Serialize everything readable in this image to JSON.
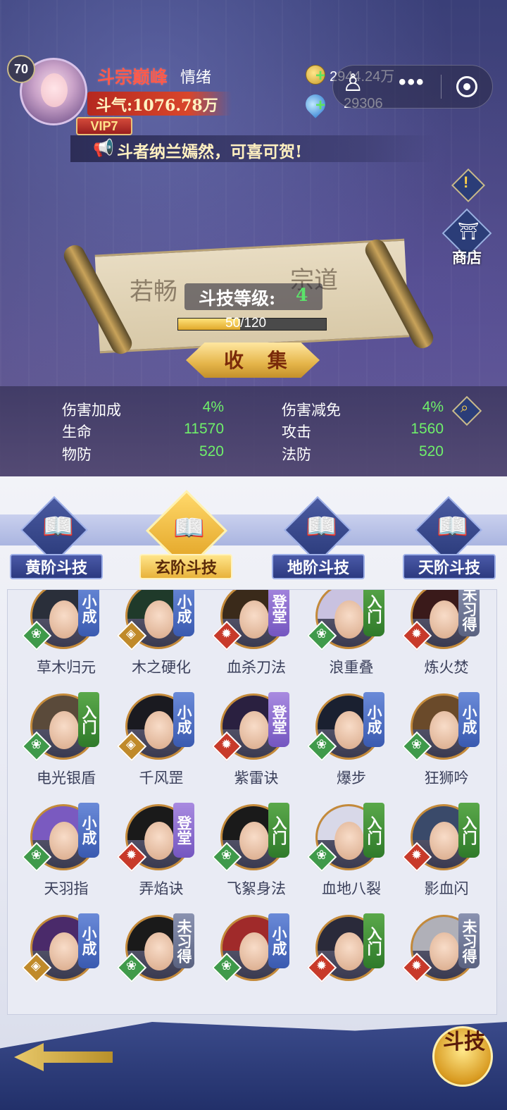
{
  "header": {
    "level": "70",
    "player_name": "斗宗巅峰",
    "mood": "情绪",
    "power": "斗气:1076.78万",
    "vip": "VIP7",
    "notice": "斗者纳兰嫣然，可喜可贺!",
    "gold": "2944.24万",
    "gems": "29306"
  },
  "side": {
    "shop_label": "商店"
  },
  "scroll": {
    "level_label": "斗技等级:",
    "level_value": "4",
    "progress_text": "50/120",
    "progress_value": 50,
    "progress_max": 120,
    "collect_label": "收 集"
  },
  "stats": {
    "damage_bonus_label": "伤害加成",
    "damage_bonus": "4%",
    "damage_reduce_label": "伤害减免",
    "damage_reduce": "4%",
    "hp_label": "生命",
    "hp": "11570",
    "attack_label": "攻击",
    "attack": "1560",
    "pdef_label": "物防",
    "pdef": "520",
    "mdef_label": "法防",
    "mdef": "520"
  },
  "tabs": [
    {
      "label": "黄阶斗技",
      "active": false
    },
    {
      "label": "玄阶斗技",
      "active": true
    },
    {
      "label": "地阶斗技",
      "active": false
    },
    {
      "label": "天阶斗技",
      "active": false
    }
  ],
  "skills": [
    {
      "name": "草木归元",
      "tag": "小成",
      "tag_color": "blue",
      "element": "wood"
    },
    {
      "name": "木之硬化",
      "tag": "小成",
      "tag_color": "blue",
      "element": "earth"
    },
    {
      "name": "血杀刀法",
      "tag": "登堂",
      "tag_color": "purple",
      "element": "fire"
    },
    {
      "name": "浪重叠",
      "tag": "入门",
      "tag_color": "green",
      "element": "wood"
    },
    {
      "name": "炼火焚",
      "tag": "未习得",
      "tag_color": "gray",
      "element": "fire"
    },
    {
      "name": "电光银盾",
      "tag": "入门",
      "tag_color": "green",
      "element": "wood"
    },
    {
      "name": "千风罡",
      "tag": "小成",
      "tag_color": "blue",
      "element": "earth"
    },
    {
      "name": "紫雷诀",
      "tag": "登堂",
      "tag_color": "purple",
      "element": "fire"
    },
    {
      "name": "爆步",
      "tag": "小成",
      "tag_color": "blue",
      "element": "wood"
    },
    {
      "name": "狂狮吟",
      "tag": "小成",
      "tag_color": "blue",
      "element": "wood"
    },
    {
      "name": "天羽指",
      "tag": "小成",
      "tag_color": "blue",
      "element": "wood"
    },
    {
      "name": "弄焰诀",
      "tag": "登堂",
      "tag_color": "purple",
      "element": "fire"
    },
    {
      "name": "飞絮身法",
      "tag": "入门",
      "tag_color": "green",
      "element": "wood"
    },
    {
      "name": "血地八裂",
      "tag": "入门",
      "tag_color": "green",
      "element": "wood"
    },
    {
      "name": "影血闪",
      "tag": "入门",
      "tag_color": "green",
      "element": "fire"
    },
    {
      "name": "",
      "tag": "小成",
      "tag_color": "blue",
      "element": "earth"
    },
    {
      "name": "",
      "tag": "未习得",
      "tag_color": "gray",
      "element": "wood"
    },
    {
      "name": "",
      "tag": "小成",
      "tag_color": "blue",
      "element": "wood"
    },
    {
      "name": "",
      "tag": "入门",
      "tag_color": "green",
      "element": "fire"
    },
    {
      "name": "",
      "tag": "未习得",
      "tag_color": "gray",
      "element": "fire"
    }
  ],
  "battle_button": "斗技"
}
